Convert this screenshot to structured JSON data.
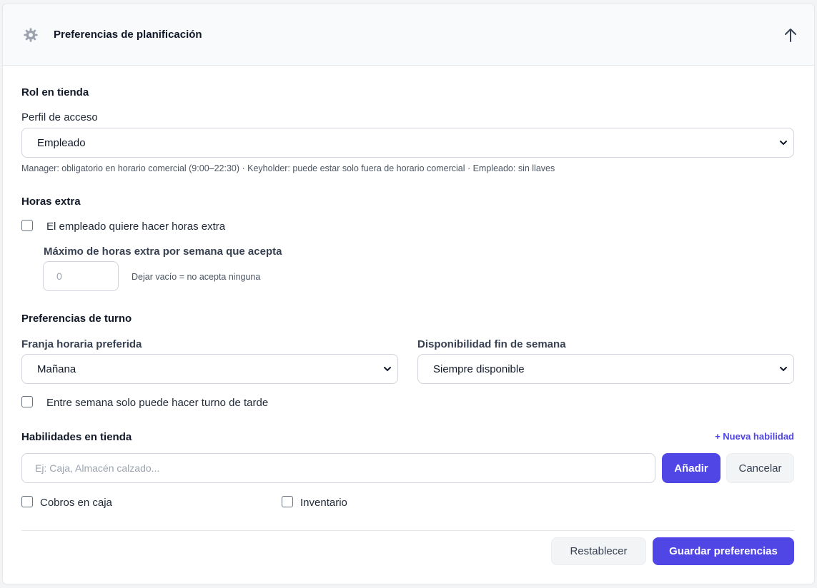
{
  "header": {
    "title": "Preferencias de planificación",
    "icon": "gear-icon",
    "collapse_icon": "arrow-up-icon"
  },
  "rol": {
    "section_title": "Rol en tienda",
    "profile_label": "Perfil de acceso",
    "profile_value": "Empleado",
    "hint": "Manager: obligatorio en horario comercial (9:00–22:30) · Keyholder: puede estar solo fuera de horario comercial · Empleado: sin llaves"
  },
  "overtime": {
    "section_title": "Horas extra",
    "checkbox_label": "El empleado quiere hacer horas extra",
    "checked": false,
    "max_label": "Máximo de horas extra por semana que acepta",
    "max_placeholder": "0",
    "max_hint": "Dejar vacío = no acepta ninguna"
  },
  "shift": {
    "section_title": "Preferencias de turno",
    "slot_label": "Franja horaria preferida",
    "slot_value": "Mañana",
    "weekend_label": "Disponibilidad fin de semana",
    "weekend_value": "Siempre disponible",
    "weekday_checkbox_label": "Entre semana solo puede hacer turno de tarde",
    "weekday_checked": false
  },
  "skills": {
    "section_title": "Habilidades en tienda",
    "new_skill_link": "+ Nueva habilidad",
    "input_placeholder": "Ej: Caja, Almacén calzado...",
    "add_button": "Añadir",
    "cancel_button": "Cancelar",
    "items": [
      {
        "label": "Cobros en caja",
        "checked": false
      },
      {
        "label": "Inventario",
        "checked": false
      }
    ]
  },
  "footer": {
    "reset_button": "Restablecer",
    "save_button": "Guardar preferencias"
  },
  "colors": {
    "primary": "#4f46e5",
    "header_bg": "#f8fafc",
    "border": "#d1d5db"
  }
}
